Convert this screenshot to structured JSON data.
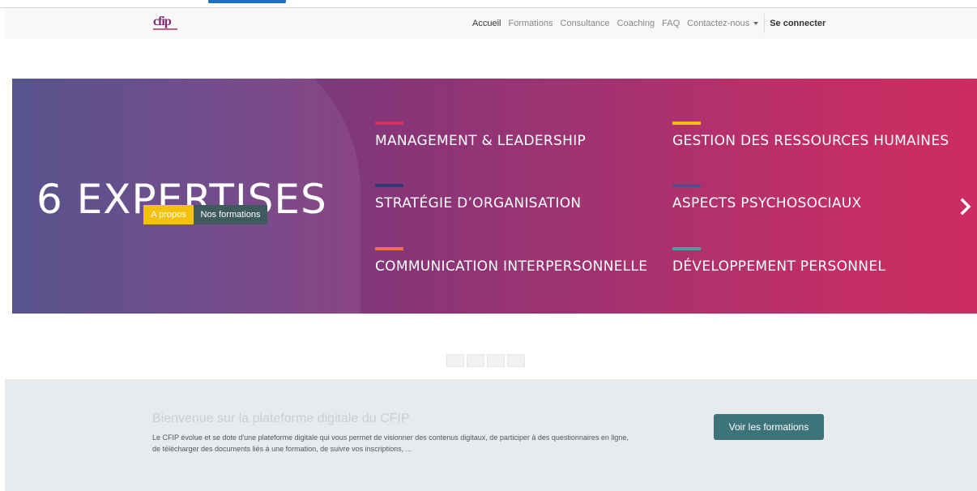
{
  "header": {
    "logo_text": "cfip",
    "nav": [
      {
        "label": "Accueil",
        "active": true
      },
      {
        "label": "Formations"
      },
      {
        "label": "Consultance"
      },
      {
        "label": "Coaching"
      },
      {
        "label": "FAQ"
      },
      {
        "label": "Contactez-nous"
      }
    ],
    "login_label": "Se connecter"
  },
  "hero": {
    "headline": "6 EXPERTISES",
    "btn_apropos": "A propos",
    "btn_nos_formations": "Nos formations",
    "expertises": [
      {
        "label": "MANAGEMENT & LEADERSHIP",
        "color": "#d9315f"
      },
      {
        "label": "GESTION DES RESSOURCES HUMAINES",
        "color": "#f4c20e"
      },
      {
        "label": "STRATÉGIE D’ORGANISATION",
        "color": "#2e3a78"
      },
      {
        "label": "ASPECTS PSYCHOSOCIAUX",
        "color": "#5a4a8a"
      },
      {
        "label": "COMMUNICATION INTERPERSONNELLE",
        "color": "#f26f45"
      },
      {
        "label": "DÉVELOPPEMENT PERSONNEL",
        "color": "#3fa3a0"
      }
    ]
  },
  "welcome": {
    "title": "Bienvenue sur la plateforme digitale du CFIP",
    "text": "Le CFIP évolue et se dote d'une plateforme digitale qui vous permet de visionner des contenus digitaux, de participer à des questionnaires en ligne, de télécharger des documents liés à une formation, de suivre vos inscriptions, ...",
    "cta": "Voir les formations"
  },
  "colors": {
    "accent_teal": "#3d7479",
    "accent_yellow": "#f4c20e",
    "hero_start": "#4b4785",
    "hero_end": "#cc2d61"
  }
}
